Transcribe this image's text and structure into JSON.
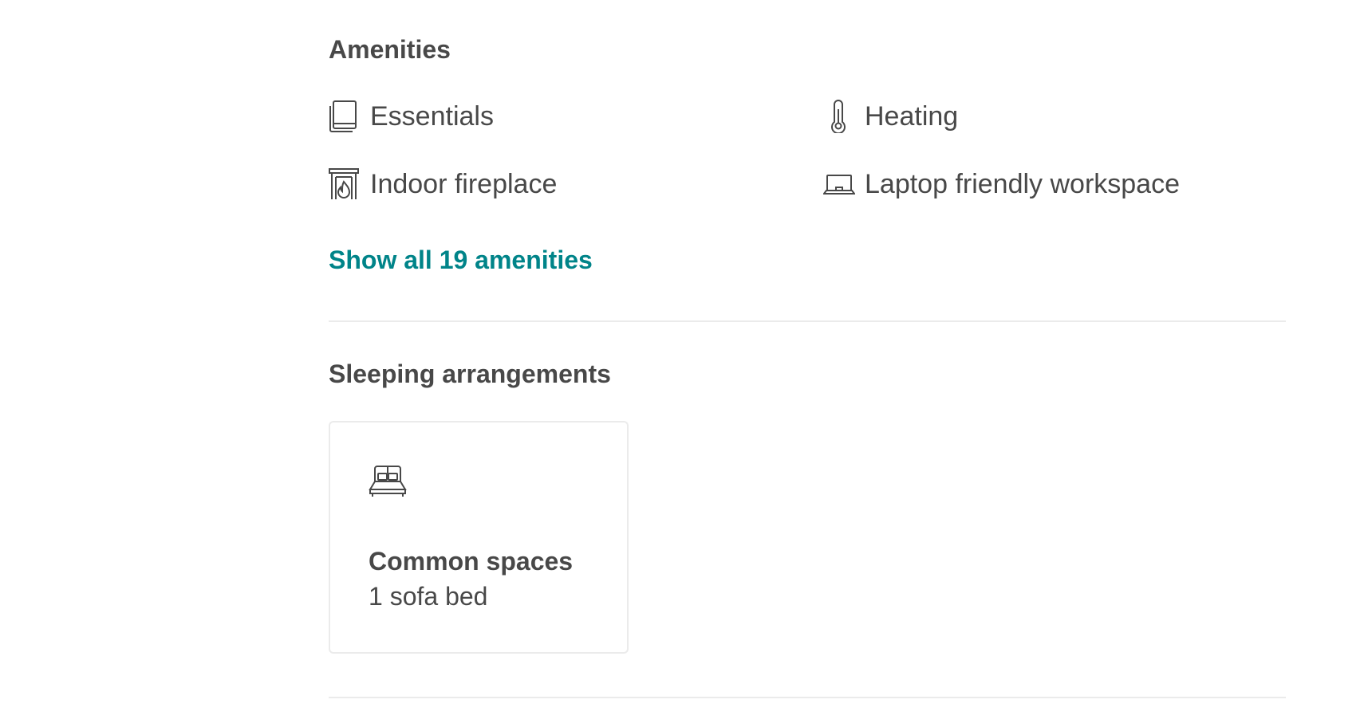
{
  "amenities": {
    "title": "Amenities",
    "items": [
      {
        "label": "Essentials",
        "icon": "towel-icon"
      },
      {
        "label": "Heating",
        "icon": "thermometer-icon"
      },
      {
        "label": "Indoor fireplace",
        "icon": "fireplace-icon"
      },
      {
        "label": "Laptop friendly workspace",
        "icon": "laptop-icon"
      }
    ],
    "show_all_label": "Show all 19 amenities"
  },
  "sleeping": {
    "title": "Sleeping arrangements",
    "cards": [
      {
        "title": "Common spaces",
        "detail": "1 sofa bed",
        "icon": "bed-icon"
      }
    ]
  },
  "colors": {
    "text": "#484848",
    "link": "#008489",
    "divider": "#ebebeb"
  }
}
